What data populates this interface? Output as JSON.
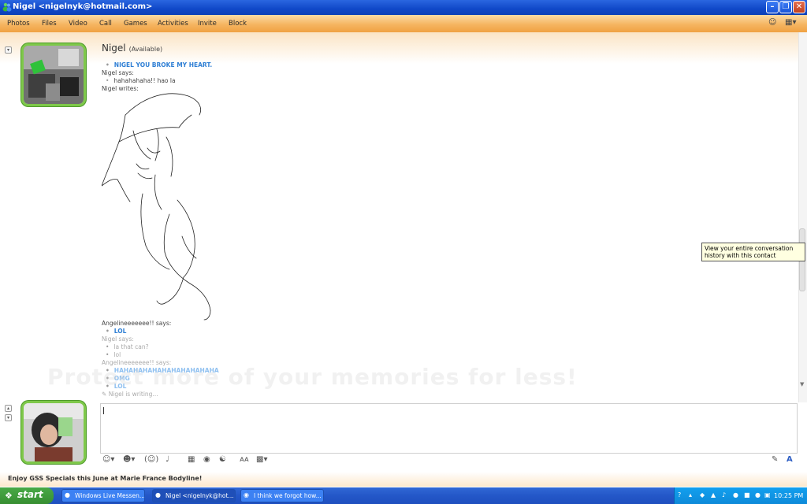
{
  "window": {
    "title": "Nigel <nigelnyk@hotmail.com>",
    "title_icon": "messenger-icon",
    "controls": [
      "minimize-icon",
      "maximize-icon",
      "close-icon"
    ]
  },
  "menu": {
    "items": [
      "Photos",
      "Files",
      "Video",
      "Call",
      "Games",
      "Activities",
      "Invite",
      "Block"
    ],
    "right_icons": [
      "smiley-status-icon",
      "toolbar-options-icon"
    ]
  },
  "contact": {
    "name": "Nigel",
    "status": "(Available)"
  },
  "conversation": {
    "msg1": "NIGEL YOU BROKE MY HEART.",
    "says1": "Nigel says:",
    "msg2": "hahahahaha!! hao la",
    "writes": "Nigel writes:",
    "says2": "Angelineeeeeee!! says:",
    "msg3": "LOL",
    "says3": "Nigel says:",
    "msg4": "la that can?",
    "msg5": "lol",
    "says4": "Angelineeeeeee!! says:",
    "msg6": "HAHAHAHAHAHAHAHAHAHAHA",
    "msg7": "OMG",
    "msg8": "LOL",
    "typing": "Nigel is writing..."
  },
  "tooltip": "View your entire conversation history with this contact",
  "watermark": "Protect more of your memories for less!",
  "input": {
    "value": ""
  },
  "compose_toolbar": [
    "emoticon-icon",
    "wink-icon",
    "nudge-icon",
    "voice-clip-icon",
    "background-icon",
    "handwriting-icon",
    "font-icon",
    "color-icon"
  ],
  "ad": "Enjoy GSS Specials this June at Marie France Bodyline!",
  "taskbar": {
    "start": "start",
    "tasks": [
      {
        "label": "Windows Live Messen...",
        "icon": "messenger-icon"
      },
      {
        "label": "Nigel <nigelnyk@hot...",
        "icon": "messenger-icon"
      },
      {
        "label": "I think we forgot how...",
        "icon": "firefox-icon"
      }
    ],
    "clock": "10:25 PM"
  },
  "colors": {
    "title_bar": "#1048c8",
    "menu_bar": "#f5b561",
    "avatar_frame": "#7ec84a",
    "message_blue": "#2f7fd4",
    "tooltip_bg": "#ffffe1",
    "start_button": "#378e32",
    "taskbar": "#2457c8"
  }
}
